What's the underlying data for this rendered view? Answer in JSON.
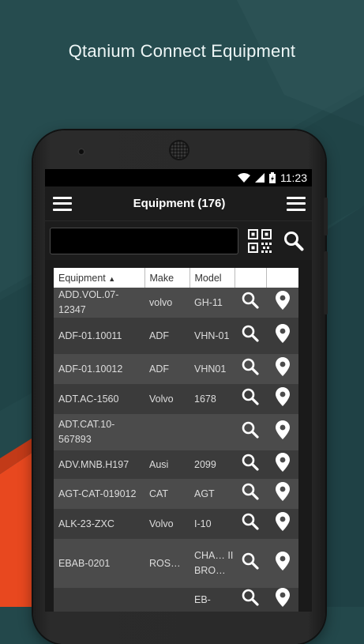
{
  "promo": {
    "title": "Qtanium Connect Equipment"
  },
  "status_bar": {
    "time": "11:23"
  },
  "app_bar": {
    "title": "Equipment (176)"
  },
  "search": {
    "value": "",
    "placeholder": ""
  },
  "table": {
    "columns": [
      "Equipment",
      "Make",
      "Model",
      "",
      ""
    ],
    "sort_indicator": "▲",
    "rows": [
      {
        "equipment": "ADD.VOL.07-12347",
        "make": "volvo",
        "model": "GH-11",
        "h": 38
      },
      {
        "equipment": "ADF-01.10011",
        "make": "ADF",
        "model": "VHN-01",
        "h": 46
      },
      {
        "equipment": "ADF-01.10012",
        "make": "ADF",
        "model": "VHN01",
        "h": 38
      },
      {
        "equipment": "ADT.AC-1560",
        "make": "Volvo",
        "model": "1678",
        "h": 38
      },
      {
        "equipment": "ADT.CAT.10-567893",
        "make": "",
        "model": "",
        "h": 46
      },
      {
        "equipment": "ADV.MNB.H197",
        "make": "Ausi",
        "model": "2099",
        "h": 36
      },
      {
        "equipment": "AGT-CAT-019012",
        "make": "CAT",
        "model": "AGT",
        "h": 38
      },
      {
        "equipment": "ALK-23-ZXC",
        "make": "Volvo",
        "model": "I-10",
        "h": 38
      },
      {
        "equipment": "EBAB-0201",
        "make": "ROS…",
        "model": "CHA… II BRO…",
        "h": 62
      },
      {
        "equipment": "",
        "make": "",
        "model": "EB-",
        "h": 30
      }
    ]
  },
  "colors": {
    "background": "#23484b",
    "accent_orange": "#e8481f",
    "row_dark": "#3b3b3b",
    "row_light": "#4b4b4b"
  },
  "icons": {
    "menu": "hamburger-icon",
    "qr": "qr-code-icon",
    "search": "search-icon",
    "magnifier": "magnifier-icon",
    "location": "map-pin-icon",
    "wifi": "wifi-icon",
    "cell": "cell-signal-icon",
    "battery": "battery-icon"
  }
}
